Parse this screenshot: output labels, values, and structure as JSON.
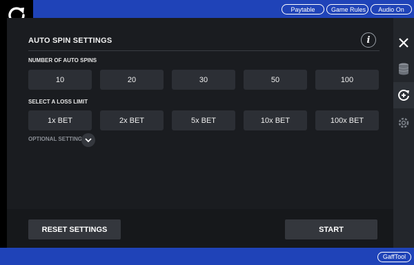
{
  "topbar": {
    "paytable_label": "Paytable",
    "game_rules_label": "Game Rules",
    "audio_label": "Audio On"
  },
  "panel": {
    "title": "AUTO SPIN SETTINGS",
    "info_symbol": "i",
    "spins_section_label": "NUMBER OF AUTO SPINS",
    "spins_options": [
      "10",
      "20",
      "30",
      "50",
      "100"
    ],
    "loss_section_label": "SELECT A LOSS LIMIT",
    "loss_options": [
      "1x BET",
      "2x BET",
      "5x BET",
      "10x BET",
      "100x BET"
    ],
    "optional_label": "OPTIONAL SETTINGS",
    "reset_label": "RESET SETTINGS",
    "start_label": "START"
  },
  "sidebar": {
    "icons": [
      "close-icon",
      "coins-icon",
      "autospin-icon",
      "settings-icon"
    ]
  },
  "footer": {
    "gafftool_label": "GaffTool"
  },
  "colors": {
    "brand_blue": "#1f43b8",
    "panel_bg": "#1a1c20",
    "button_bg": "#2c2f35"
  }
}
